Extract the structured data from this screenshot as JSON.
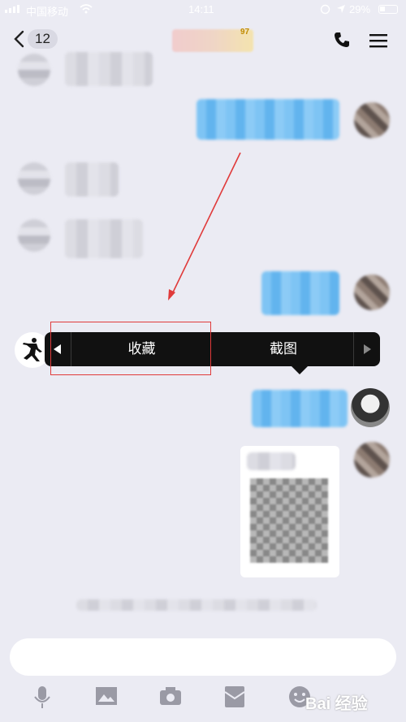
{
  "status_bar": {
    "carrier": "中国移动",
    "time": "14:11",
    "battery": "29%"
  },
  "header": {
    "back_count": "12",
    "title_tag": "97"
  },
  "context_menu": {
    "favorite": "收藏",
    "screenshot": "截图"
  },
  "watermark": "Bai 经验",
  "colors": {
    "accent_blue": "#62b4ee",
    "highlight": "#e03a3a",
    "menu_bg": "#111111"
  }
}
